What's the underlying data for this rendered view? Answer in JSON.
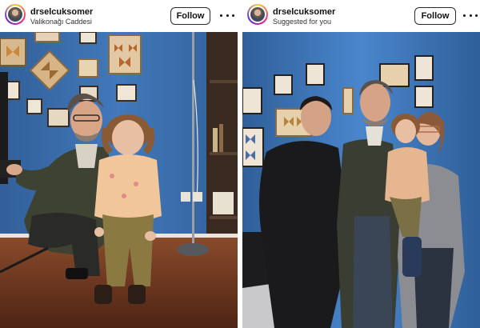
{
  "posts": [
    {
      "username": "drselcuksomer",
      "subtitle": "Valikonağı Caddesi",
      "follow_label": "Follow",
      "more_icon": "more-horizontal-icon",
      "photo_description": "Man crouching beside a curly-haired toddler in front of a blue wall with framed butterfly displays"
    },
    {
      "username": "drselcuksomer",
      "subtitle": "Suggested for you",
      "follow_label": "Follow",
      "more_icon": "more-horizontal-icon",
      "photo_description": "Group of three adults and a toddler posing in front of a blue wall with framed butterfly displays"
    }
  ],
  "colors": {
    "wall_blue": "#3d73b4",
    "floor_wood": "#6b3a22",
    "avatar_ring": "#ee2a7b"
  }
}
